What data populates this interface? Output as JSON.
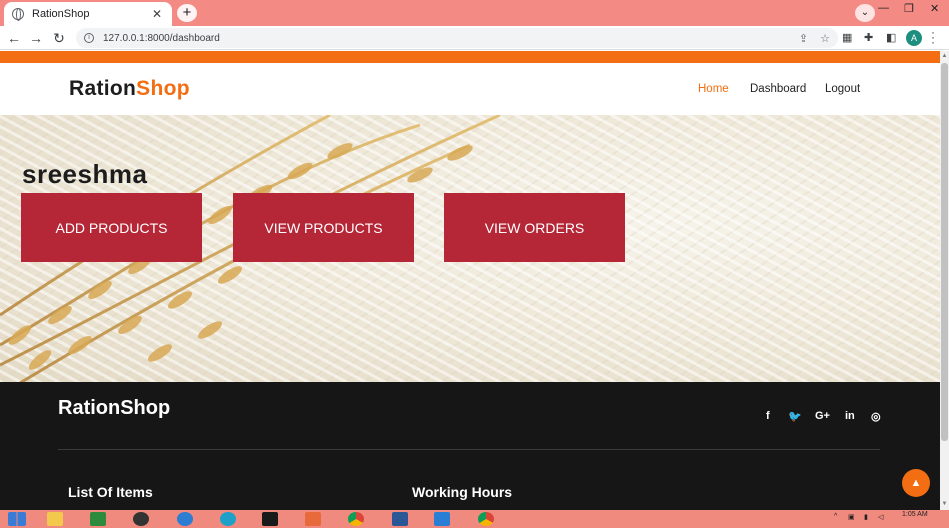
{
  "browser": {
    "tab_title": "RationShop",
    "tab_close": "✕",
    "new_tab": "+",
    "url": "127.0.0.1:8000/dashboard",
    "profile_initial": "A"
  },
  "site": {
    "logo_part1": "Ration",
    "logo_part2": "Shop",
    "nav": [
      "Home",
      "Dashboard",
      "Logout"
    ],
    "active_nav": "Home",
    "accent_color": "#f36d12",
    "button_color": "#b52637"
  },
  "hero": {
    "username": "sreeshma",
    "buttons": [
      "ADD PRODUCTS",
      "VIEW PRODUCTS",
      "VIEW ORDERS"
    ]
  },
  "footer": {
    "logo": "RationShop",
    "social_icons": [
      "facebook-icon",
      "twitter-icon",
      "google-plus-icon",
      "linkedin-icon",
      "instagram-icon"
    ],
    "social_glyphs": [
      "f",
      "🐦",
      "G+",
      "in",
      "◎"
    ],
    "headings": [
      "List Of Items",
      "Working Hours"
    ]
  },
  "taskbar": {
    "time": "1:05 AM"
  }
}
